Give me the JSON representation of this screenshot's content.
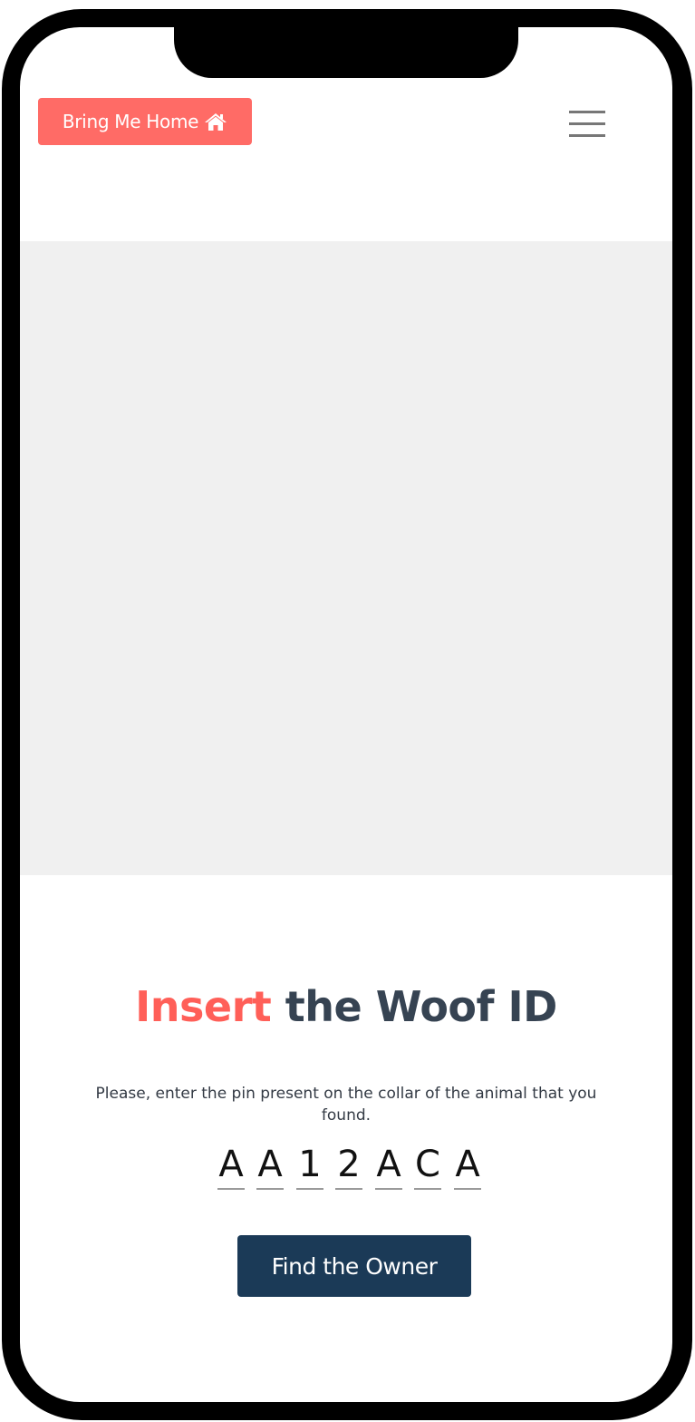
{
  "header": {
    "brand_label": "Bring Me Home",
    "brand_icon": "home-icon",
    "menu_icon": "hamburger-menu-icon"
  },
  "hero": {
    "background_color": "#f0f0f0"
  },
  "main": {
    "title_accent": "Insert",
    "title_rest": " the Woof ID",
    "instructions": "Please, enter the pin present on the collar of the animal that you found.",
    "pin": [
      "A",
      "A",
      "1",
      "2",
      "A",
      "C",
      "A"
    ],
    "submit_label": "Find the Owner"
  },
  "colors": {
    "accent": "#ff6b66",
    "heading_dark": "#364352",
    "button_dark": "#1b3a57"
  }
}
